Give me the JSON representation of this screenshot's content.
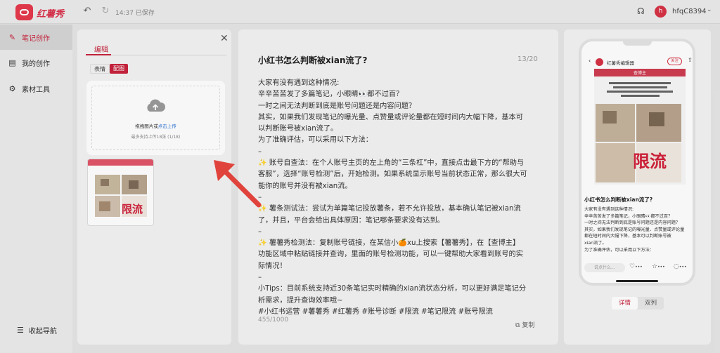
{
  "topbar": {
    "app_name": "红薯秀",
    "saved_status": "14:37 已保存",
    "username": "hfqC8394",
    "avatar_letter": "h"
  },
  "sidebar": {
    "items": [
      {
        "label": "笔记创作",
        "icon": "note-icon",
        "active": true
      },
      {
        "label": "我的创作",
        "icon": "document-icon",
        "active": false
      },
      {
        "label": "素材工具",
        "icon": "gear-icon",
        "active": false
      }
    ],
    "collapse_label": "收起导航"
  },
  "editor_panel": {
    "tab_label": "编辑",
    "segments": [
      "表情",
      "配图"
    ],
    "upload_text": "拖拽图片或",
    "upload_link": "点击上传",
    "upload_hint": "最多支持上传18张 (1/18)",
    "thumb_limit_text": "限流"
  },
  "note": {
    "title": "小红书怎么判断被xian流了?",
    "title_count": "13/20",
    "lines": [
      "大家有没有遇到这种情况:",
      "辛辛苦苦发了多篇笔记，小眼睛👀都不过百？",
      "一时之间无法判断到底是账号问题还是内容问题？",
      "其实，如果我们发现笔记的曝光量、点赞量或评论量都在短时间内大幅下降，基本可",
      "以判断账号被xian流了。",
      "为了准确评估，可以采用以下方法：",
      "–",
      "✨ 账号自查法：在个人账号主页的左上角的“三条杠”中，直接点击最下方的“帮助与",
      "客服”，选择“账号检测”后，开始检测。如果系统显示账号当前状态正常，那么很大可",
      "能你的账号并没有被xian流。",
      "–",
      "✨ 薯条测试法：尝试为单篇笔记投放薯条，若不允许投放，基本确认笔记被xian流",
      "了，并且，平台会给出具体原因：笔记哪条要求没有达到。",
      "–",
      "✨ 薯薯秀检测法：复制账号链接，在某信小🍊xu上搜索【薯薯秀】，在【查博主】",
      "功能区域中粘贴链接并查询，里面的账号检测功能，可以一键帮助大家看到账号的实",
      "际情况！",
      "–",
      "小Tips：目前系统支持近30条笔记实时精确的xian流状态分析，可以更好满足笔记分",
      "析需求，提升查询效率哦~",
      "#小红书运营 #薯薯秀 #红薯秀 #账号诊断 #限流 #笔记限流 #账号限流"
    ],
    "char_count": "455/1000",
    "copy_label": "复制"
  },
  "preview": {
    "account_name": "红薯秀编辑器",
    "follow_label": "关注",
    "image_header": "查博主",
    "image_limit_text": "限流",
    "title": "小红书怎么判断被xian流了?",
    "lines": [
      "大家有没有遇到这种情况:",
      "辛辛苦苦发了多篇笔记，小眼睛👀都不过百？",
      "一时之间无法判断到底是账号问题还是内容问题？",
      "其实，如果我们发现笔记的曝光量、点赞量或评论量",
      "都在短时间内大幅下降，基本可以判断账号被",
      "xian流了。",
      "为了准确评估，可以采用以下方法："
    ],
    "comment_placeholder": "说点什么...",
    "action_dots": "•••",
    "view_tabs": [
      "详情",
      "双列"
    ]
  }
}
